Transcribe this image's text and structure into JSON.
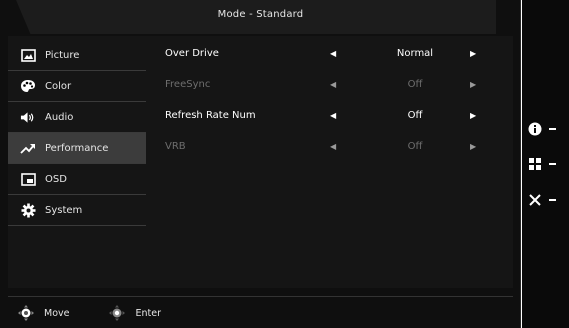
{
  "title": "Mode - Standard",
  "sidebar": {
    "items": [
      {
        "label": "Picture",
        "icon": "picture-icon"
      },
      {
        "label": "Color",
        "icon": "palette-icon"
      },
      {
        "label": "Audio",
        "icon": "speaker-icon"
      },
      {
        "label": "Performance",
        "icon": "trend-icon",
        "active": true
      },
      {
        "label": "OSD",
        "icon": "osd-window-icon"
      },
      {
        "label": "System",
        "icon": "gear-icon"
      }
    ]
  },
  "settings": [
    {
      "label": "Over Drive",
      "value": "Normal",
      "enabled": true
    },
    {
      "label": "FreeSync",
      "value": "Off",
      "enabled": false
    },
    {
      "label": "Refresh Rate Num",
      "value": "Off",
      "enabled": true
    },
    {
      "label": "VRB",
      "value": "Off",
      "enabled": false
    }
  ],
  "footer": {
    "move_label": "Move",
    "enter_label": "Enter"
  },
  "side_buttons": [
    {
      "icon": "info-icon"
    },
    {
      "icon": "grid-menu-icon"
    },
    {
      "icon": "close-icon"
    }
  ],
  "colors": {
    "background": "#0f0f0f",
    "active_item": "#3c3c3c",
    "disabled_text": "#6e6e6e"
  }
}
